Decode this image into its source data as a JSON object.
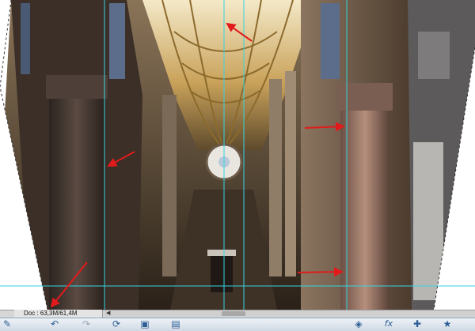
{
  "status": {
    "doc_info": "Doc : 63,3M/61,4M"
  },
  "icons": {
    "tools": "edit-icon",
    "undo": "undo-icon",
    "redo": "redo-icon",
    "rotate": "rotate-icon",
    "frame": "frame-icon",
    "window": "window-icon",
    "layers": "layers-icon",
    "fx": "fx-icon",
    "add": "add-icon",
    "favorite": "star-icon"
  },
  "colors": {
    "guide": "#37d3e0",
    "arrow": "#e11b1b",
    "statusbar": "#d6d6d6",
    "taskbar_icon": "#2d5f96"
  }
}
